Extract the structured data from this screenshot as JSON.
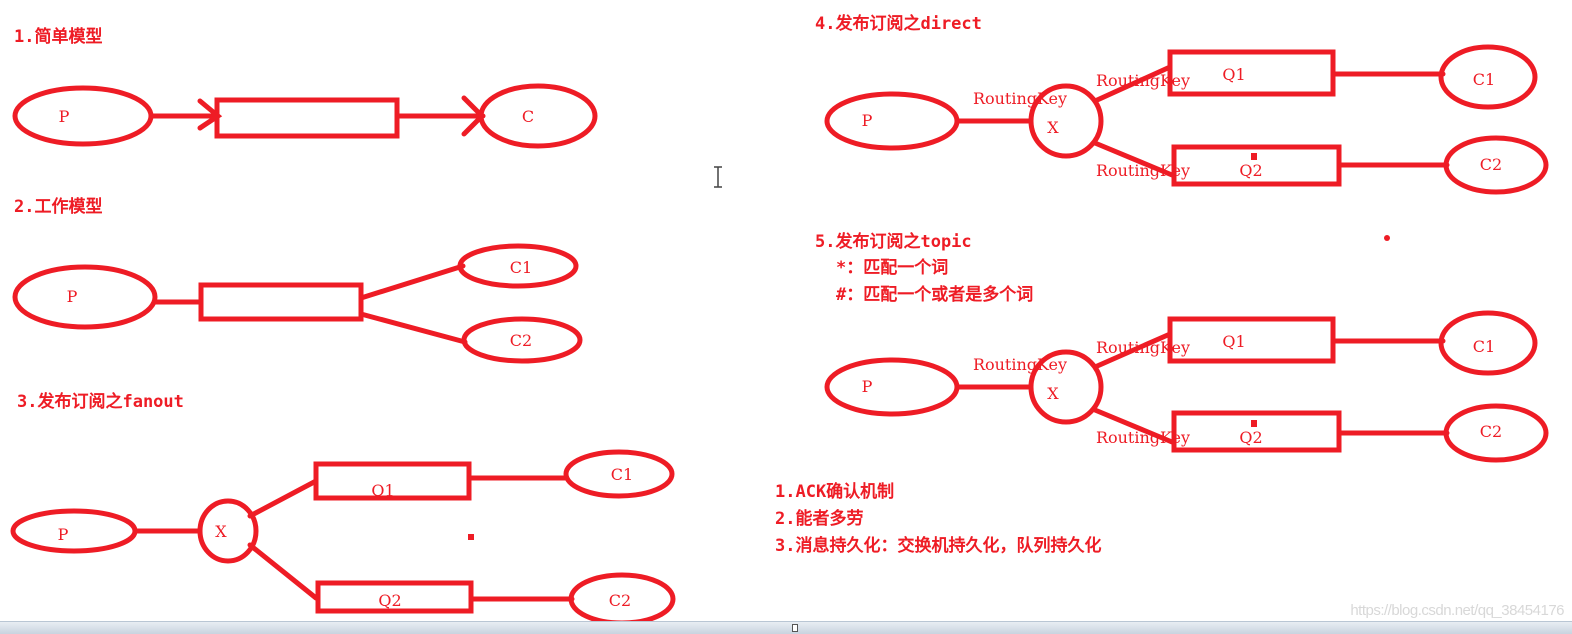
{
  "colors": {
    "stroke": "#ee1c25",
    "text": "#ee1c25",
    "background": "#ffffff",
    "watermark": "#d8d8d8"
  },
  "sections": {
    "simple": {
      "title": "1.简单模型",
      "producer": "P",
      "queue": "",
      "consumer": "C"
    },
    "work": {
      "title": "2.工作模型",
      "producer": "P",
      "queue": "",
      "consumers": [
        "C1",
        "C2"
      ]
    },
    "fanout": {
      "title": "3.发布订阅之fanout",
      "producer": "P",
      "exchange": "X",
      "queues": [
        "Q1",
        "Q2"
      ],
      "consumers": [
        "C1",
        "C2"
      ]
    },
    "direct": {
      "title": "4.发布订阅之direct",
      "producer": "P",
      "exchange": "X",
      "routing_key": "RoutingKey",
      "queues": [
        "Q1",
        "Q2"
      ],
      "consumers": [
        "C1",
        "C2"
      ]
    },
    "topic": {
      "title": "5.发布订阅之topic",
      "notes": [
        "*：匹配一个词",
        "#：匹配一个或者是多个词"
      ],
      "producer": "P",
      "exchange": "X",
      "routing_key": "RoutingKey",
      "queues": [
        "Q1",
        "Q2"
      ],
      "consumers": [
        "C1",
        "C2"
      ]
    }
  },
  "features": [
    "1.ACK确认机制",
    "2.能者多劳",
    "3.消息持久化：交换机持久化，队列持久化"
  ],
  "watermark": "https://blog.csdn.net/qq_38454176"
}
